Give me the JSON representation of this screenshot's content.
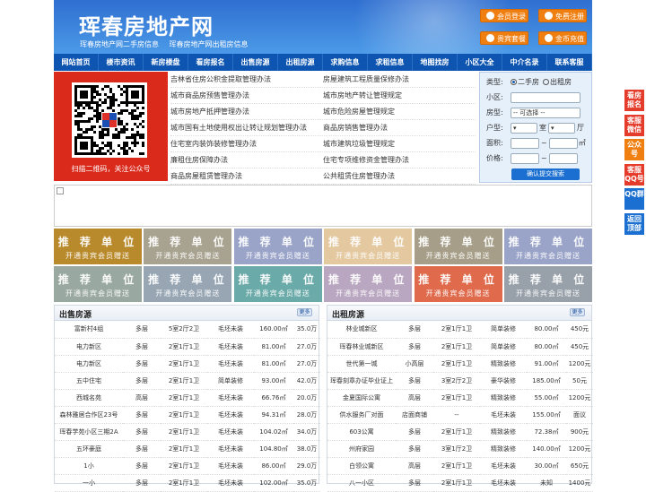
{
  "header": {
    "logo": "珲春房地产网",
    "sub_links": [
      "珲春房地产网二手房信息",
      "珲春房地产网出租房信息"
    ],
    "buttons": {
      "login": "会员登录",
      "register": "免费注册",
      "package": "贵宾套餐",
      "recharge": "金币充值"
    }
  },
  "nav": [
    "网站首页",
    "楼市资讯",
    "新房楼盘",
    "看房报名",
    "出售房源",
    "出租房源",
    "求购信息",
    "求租信息",
    "地图找房",
    "小区大全",
    "中介名录",
    "联系客服"
  ],
  "qr": {
    "caption": "扫描二维码，关注公众号"
  },
  "news": {
    "left": [
      "吉林省住房公积金提取管理办法",
      "城市商品房预售管理办法",
      "城市房地产抵押管理办法",
      "城市国有土地使用权出让转让规划管理办法",
      "住宅室内装饰装修管理办法",
      "廉租住房保障办法",
      "商品房屋租赁管理办法"
    ],
    "right": [
      "房屋建筑工程质量保修办法",
      "城市房地产转让管理规定",
      "城市危险房屋管理规定",
      "商品房销售管理办法",
      "城市建筑垃圾管理规定",
      "住宅专项维修资金管理办法",
      "公共租赁住房管理办法"
    ]
  },
  "search": {
    "type_label": "类型:",
    "opt_sale": "二手房",
    "opt_rent": "出租房",
    "community_label": "小区:",
    "house_label": "房型:",
    "house_placeholder": "-- 可选择 --",
    "layout_label": "户型:",
    "room": "室",
    "hall": "厅",
    "area_label": "面积:",
    "area_unit": "㎡",
    "price_label": "价格:",
    "tilde": "~",
    "button": "确认提交搜索"
  },
  "ads": {
    "line1": "推 荐 单 位",
    "line2": "开通贵宾会员赠送",
    "colors": [
      "#b98a2c",
      "#a8a290",
      "#9aa4c9",
      "#e4c9a0",
      "#a69e88",
      "#9aa4c9",
      "#9aa8a2",
      "#98a6b4",
      "#6aaaa8",
      "#b9a6c0",
      "#e06a4c",
      "#98a0aa"
    ]
  },
  "sale": {
    "title": "出售房源",
    "more": "更多",
    "rows": [
      [
        "富新村4组",
        "多层",
        "5室2厅2卫",
        "毛坯未装",
        "160.00㎡",
        "35.0万"
      ],
      [
        "电力新区",
        "多层",
        "2室1厅1卫",
        "毛坯未装",
        "81.00㎡",
        "27.0万"
      ],
      [
        "电力新区",
        "多层",
        "2室1厅1卫",
        "毛坯未装",
        "81.00㎡",
        "27.0万"
      ],
      [
        "五中住宅",
        "多层",
        "2室1厅1卫",
        "简单装修",
        "93.00㎡",
        "42.0万"
      ],
      [
        "西城名苑",
        "高层",
        "2室1厅1卫",
        "毛坯未装",
        "66.76㎡",
        "20.0万"
      ],
      [
        "森林雅居合作区23号",
        "多层",
        "2室1厅1卫",
        "毛坯未装",
        "94.31㎡",
        "28.0万"
      ],
      [
        "珲春学苑小区三期2A",
        "多层",
        "2室1厅1卫",
        "毛坯未装",
        "104.02㎡",
        "34.0万"
      ],
      [
        "五环豪庭",
        "多层",
        "2室1厅1卫",
        "毛坯未装",
        "104.80㎡",
        "38.0万"
      ],
      [
        "1小",
        "多层",
        "2室1厅1卫",
        "毛坯未装",
        "86.00㎡",
        "29.0万"
      ],
      [
        "一小",
        "多层",
        "2室1厅1卫",
        "毛坯未装",
        "102.00㎡",
        "35.0万"
      ]
    ]
  },
  "rent": {
    "title": "出租房源",
    "more": "更多",
    "rows": [
      [
        "林业城新区",
        "多层",
        "2室1厅1卫",
        "简单装修",
        "80.00㎡",
        "450元"
      ],
      [
        "珲春林业城新区",
        "多层",
        "2室1厅1卫",
        "简单装修",
        "80.00㎡",
        "450元"
      ],
      [
        "世代第一城",
        "小高层",
        "2室1厅1卫",
        "精致装修",
        "91.00㎡",
        "1200元"
      ],
      [
        "珲春刻章办证毕业证上",
        "多层",
        "3室2厅2卫",
        "豪华装修",
        "185.00㎡",
        "50元"
      ],
      [
        "金夏国际公寓",
        "高层",
        "2室1厅1卫",
        "精致装修",
        "55.00㎡",
        "1200元"
      ],
      [
        "供水服务厂对面",
        "店面商铺",
        "--",
        "毛坯未装",
        "155.00㎡",
        "面议"
      ],
      [
        "603公寓",
        "多层",
        "2室1厅1卫",
        "精致装修",
        "72.38㎡",
        "900元"
      ],
      [
        "州府家园",
        "多层",
        "3室1厅2卫",
        "精致装修",
        "140.00㎡",
        "1200元"
      ],
      [
        "白领公寓",
        "高层",
        "2室1厅1卫",
        "毛坯未装",
        "30.00㎡",
        "650元"
      ],
      [
        "八一小区",
        "多层",
        "2室1厅1卫",
        "毛坯未装",
        "未知",
        "1400元"
      ]
    ]
  },
  "sidebar": [
    "看房报名",
    "客服微信",
    "公众号",
    "客服QQ号",
    "QQ群",
    "返回顶部"
  ],
  "sidebar_colors": [
    "#e53b2a",
    "#e53b2a",
    "#f07f12",
    "#e53b2a",
    "#1a6fd0",
    "#1a6fd0"
  ]
}
